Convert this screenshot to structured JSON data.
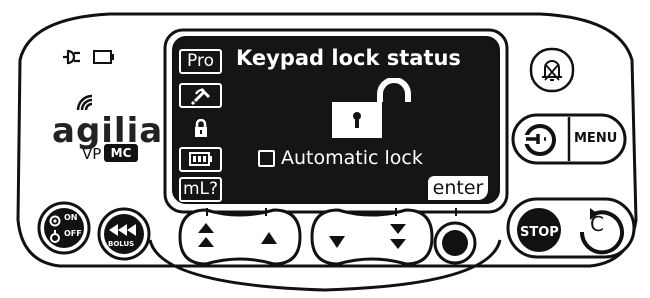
{
  "device": {
    "brand": "agilia",
    "model_prefix": "VP",
    "model_badge": "MC"
  },
  "screen": {
    "title": "Keypad lock status",
    "side_tabs": [
      "Pro",
      "syringe-icon",
      "lock-icon",
      "battery-icon",
      "mL?"
    ],
    "active_tab_index": 2,
    "checkbox_label": "Automatic lock",
    "checkbox_checked": false,
    "softkey_label": "enter"
  },
  "buttons": {
    "on_label": "ON",
    "off_label": "OFF",
    "bolus_label": "BOLUS",
    "stop_label": "STOP",
    "menu_label": "MENU",
    "clear_label": "C"
  },
  "colors": {
    "screen_bg": "#151515",
    "body_outline": "#111111"
  }
}
